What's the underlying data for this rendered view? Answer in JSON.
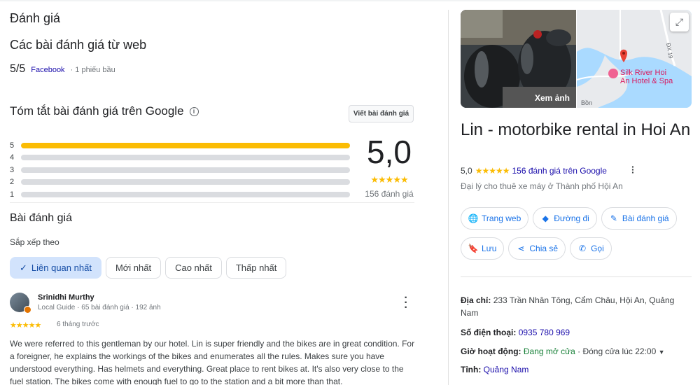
{
  "left": {
    "page_title": "Đánh giá",
    "web_reviews_title": "Các bài đánh giá từ web",
    "web_score": "5/5",
    "web_source": "Facebook",
    "web_votes": "· 1 phiếu bầu",
    "summary_title": "Tóm tắt bài đánh giá trên Google",
    "write_review_label": "Viết bài đánh giá",
    "distribution": [
      {
        "star": "5",
        "fraction": 1.0
      },
      {
        "star": "4",
        "fraction": 0.0
      },
      {
        "star": "3",
        "fraction": 0.0
      },
      {
        "star": "2",
        "fraction": 0.0
      },
      {
        "star": "1",
        "fraction": 0.0
      }
    ],
    "overall_score": "5,0",
    "overall_stars": "★★★★★",
    "overall_count": "156 đánh giá",
    "reviews_title": "Bài đánh giá",
    "sort_label": "Sắp xếp theo",
    "sort_chips": [
      {
        "label": "Liên quan nhất",
        "selected": true
      },
      {
        "label": "Mới nhất",
        "selected": false
      },
      {
        "label": "Cao nhất",
        "selected": false
      },
      {
        "label": "Thấp nhất",
        "selected": false
      }
    ],
    "review": {
      "author": "Srinidhi Murthy",
      "meta": "Local Guide · 65 bài đánh giá · 192 ảnh",
      "stars": "★★★★★",
      "time": "6 tháng trước",
      "text": "We were referred to this gentleman by our hotel. Lin is super friendly and the bikes are in great condition. For a foreigner, he explains the workings of the bikes and enumerates all the rules. Makes sure you have understood everything. Has helmets and everything. Great place to rent bikes at. It's also very close to the fuel station. The bikes come with enough fuel to go to the station and a bit more than that."
    }
  },
  "right": {
    "photo_label": "Xem ảnh",
    "map_labels": {
      "road": "ĐX 19",
      "hotel": "Silk River Hoi An Hotel & Spa",
      "hotel_line1": "Silk River Hoi",
      "hotel_line2": "An Hotel & Spa",
      "place": "Bồn"
    },
    "business_name": "Lin - motorbike rental in Hoi An",
    "score": "5,0",
    "stars": "★★★★★",
    "reviews_link": "156 đánh giá trên Google",
    "category": "Đại lý cho thuê xe máy ở Thành phố Hội An",
    "actions_row1": [
      {
        "label": "Trang web",
        "icon": "globe-icon"
      },
      {
        "label": "Đường đi",
        "icon": "directions-icon"
      },
      {
        "label": "Bài đánh giá",
        "icon": "review-icon"
      }
    ],
    "actions_row2": [
      {
        "label": "Lưu",
        "icon": "bookmark-icon"
      },
      {
        "label": "Chia sẻ",
        "icon": "share-icon"
      },
      {
        "label": "Gọi",
        "icon": "phone-icon"
      }
    ],
    "address_label": "Địa chỉ:",
    "address_value": "233 Trần Nhân Tông, Cẩm Châu, Hội An, Quảng Nam",
    "phone_label": "Số điện thoại:",
    "phone_value": "0935 780 969",
    "hours_label": "Giờ hoạt động:",
    "hours_status": "Đang mở cửa",
    "hours_close": "· Đóng cửa lúc 22:00",
    "province_label": "Tỉnh:",
    "province_value": "Quảng Nam"
  },
  "colors": {
    "star": "#fbbc04",
    "link": "#1a0dab",
    "accent": "#1a73e8",
    "open": "#188038",
    "chip_selected_bg": "#d2e3fc"
  }
}
